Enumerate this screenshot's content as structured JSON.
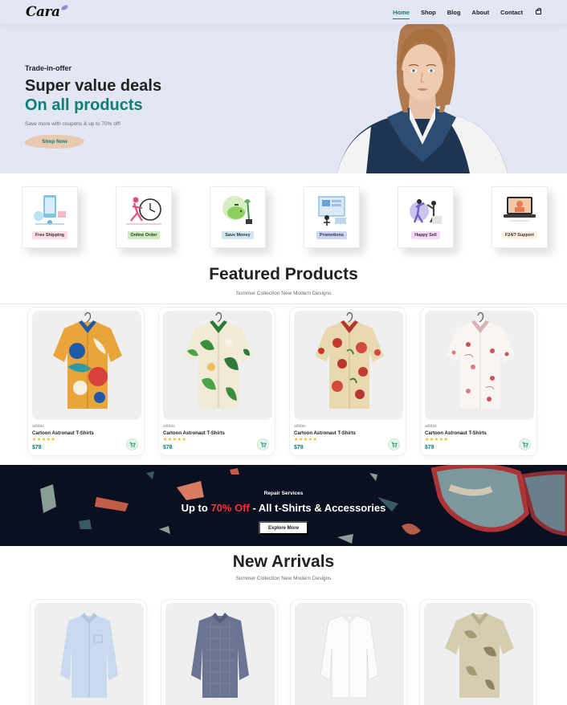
{
  "header": {
    "logo": "Cara",
    "nav": [
      "Home",
      "Shop",
      "Blog",
      "About",
      "Contact"
    ],
    "active_nav": "Home"
  },
  "hero": {
    "eyebrow": "Trade-in-offer",
    "title": "Super value deals",
    "title_accent": "On all products",
    "subtitle": "Save more with coupons & up to 70% off!",
    "button": "Shop Now"
  },
  "features": [
    {
      "label": "Free Shipping",
      "badge_color": "#fddde4",
      "icon": "free-shipping-illustration"
    },
    {
      "label": "Online Order",
      "badge_color": "#cdebbc",
      "icon": "online-order-illustration"
    },
    {
      "label": "Save Money",
      "badge_color": "#d1e8f2",
      "icon": "save-money-illustration"
    },
    {
      "label": "Promotions",
      "badge_color": "#cdd4f8",
      "icon": "promotions-illustration"
    },
    {
      "label": "Happy Sell",
      "badge_color": "#f6dbf6",
      "icon": "happy-sell-illustration"
    },
    {
      "label": "F24/7 Support",
      "badge_color": "#fff2e5",
      "icon": "support-illustration"
    }
  ],
  "featured": {
    "title": "Featured Products",
    "subtitle": "Summer Collection New Modern Designs",
    "products": [
      {
        "brand": "adidas",
        "name": "Cartoon Astronaut T-Shirts",
        "stars": "★★★★★",
        "price": "$78"
      },
      {
        "brand": "adidas",
        "name": "Cartoon Astronaut T-Shirts",
        "stars": "★★★★★",
        "price": "$78"
      },
      {
        "brand": "adidas",
        "name": "Cartoon Astronaut T-Shirts",
        "stars": "★★★★★",
        "price": "$78"
      },
      {
        "brand": "adidas",
        "name": "Cartoon Astronaut T-Shirts",
        "stars": "★★★★★",
        "price": "$78"
      }
    ]
  },
  "banner": {
    "eyebrow": "Repair Services",
    "title_prefix": "Up to ",
    "title_accent": "70% Off",
    "title_suffix": " - All t-Shirts & Accessories",
    "button": "Explore More"
  },
  "arrivals": {
    "title": "New Arrivals",
    "subtitle": "Summer Collection New Modern Designs"
  },
  "colors": {
    "accent": "#088178",
    "hero_bg": "#e3e6f3",
    "banner_bg": "#0a1020",
    "sale_red": "#ef3636"
  }
}
